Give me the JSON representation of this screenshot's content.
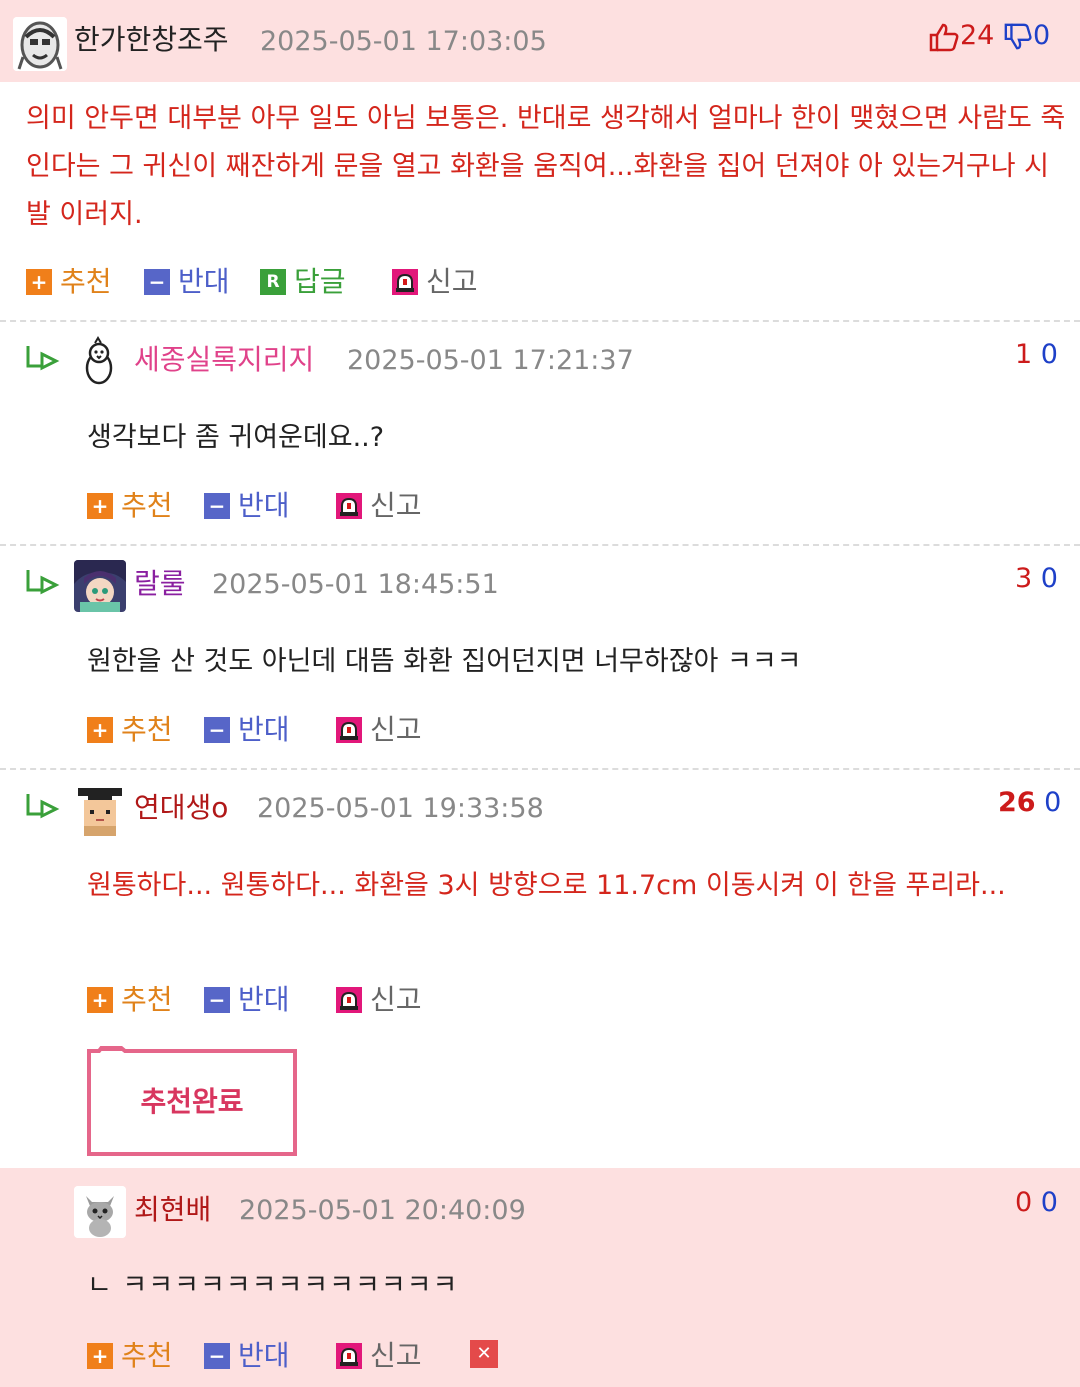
{
  "main_comment": {
    "nick": "한가한창조주",
    "date": "2025-05-01 17:03:05",
    "likes": "24",
    "dislikes": "0",
    "text": "의미 안두면 대부분 아무 일도 아님 보통은. 반대로 생각해서 얼마나 한이 맺혔으면 사람도 죽인다는 그 귀신이 째잔하게 문을 열고 화환을 움직여...화환을 집어 던져야 아 있는거구나 시발 이러지.",
    "actions": {
      "recommend": "추천",
      "oppose": "반대",
      "reply": "답글",
      "report": "신고"
    }
  },
  "replies": [
    {
      "nick": "세종실록지리지",
      "date": "2025-05-01 17:21:37",
      "likes": "1",
      "dislikes": "0",
      "text": "생각보다 좀 귀여운데요..?",
      "nick_color": "#e0428a",
      "text_color": "#222",
      "avatar_icon": "chick-icon"
    },
    {
      "nick": "랄룰",
      "date": "2025-05-01 18:45:51",
      "likes": "3",
      "dislikes": "0",
      "text": "원한을 산 것도 아닌데 대뜸 화환 집어던지면 너무하잖아 ㅋㅋㅋ",
      "nick_color": "#8a1fa0",
      "text_color": "#222",
      "avatar_icon": "anime-character-icon"
    },
    {
      "nick": "연대생o",
      "date": "2025-05-01 19:33:58",
      "likes": "26",
      "dislikes": "0",
      "text": "원통하다... 원통하다... 화환을 3시 방향으로 11.7cm 이동시켜 이 한을 푸리라...",
      "nick_color": "#b01818",
      "text_color": "#d4261c",
      "avatar_icon": "pixel-graduate-icon"
    },
    {
      "nick": "최현배",
      "date": "2025-05-01 20:40:09",
      "likes": "0",
      "dislikes": "0",
      "text": "ㄴ ㅋㅋㅋㅋㅋㅋㅋㅋㅋㅋㅋㅋㅋ",
      "nick_color": "#b01818",
      "text_color": "#222",
      "avatar_icon": "cat-icon"
    }
  ],
  "reply_actions": {
    "recommend": "추천",
    "oppose": "반대",
    "report": "신고"
  },
  "recommend_done_popup": "추천완료",
  "colors": {
    "highlight_bg": "#fde0e0",
    "recommend": "#f07f1a",
    "oppose": "#5766c8",
    "reply": "#3aa03a",
    "report": "#e2177a",
    "popup_border": "#e5668a",
    "popup_text": "#d8365f"
  }
}
